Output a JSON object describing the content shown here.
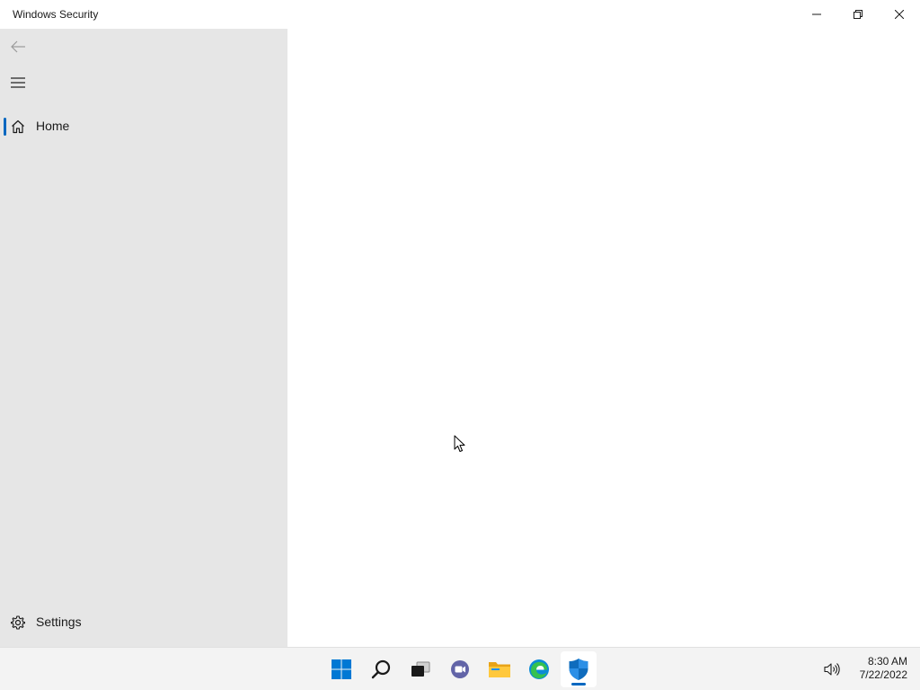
{
  "window": {
    "title": "Windows Security"
  },
  "sidebar": {
    "items": [
      {
        "label": "Home",
        "icon": "home-icon",
        "selected": true
      }
    ],
    "footer": {
      "label": "Settings",
      "icon": "gear-icon"
    }
  },
  "taskbar": {
    "apps": [
      {
        "name": "start",
        "icon": "windows-logo-icon"
      },
      {
        "name": "search",
        "icon": "search-icon"
      },
      {
        "name": "task-view",
        "icon": "task-view-icon"
      },
      {
        "name": "chat",
        "icon": "chat-icon"
      },
      {
        "name": "file-explorer",
        "icon": "folder-icon"
      },
      {
        "name": "edge",
        "icon": "edge-icon"
      },
      {
        "name": "windows-security",
        "icon": "shield-icon",
        "active": true
      }
    ],
    "clock": {
      "time": "8:30 AM",
      "date": "7/22/2022"
    }
  },
  "colors": {
    "accent": "#0067c0",
    "sidebar_bg": "#e6e6e6",
    "taskbar_bg": "#f3f3f3"
  }
}
